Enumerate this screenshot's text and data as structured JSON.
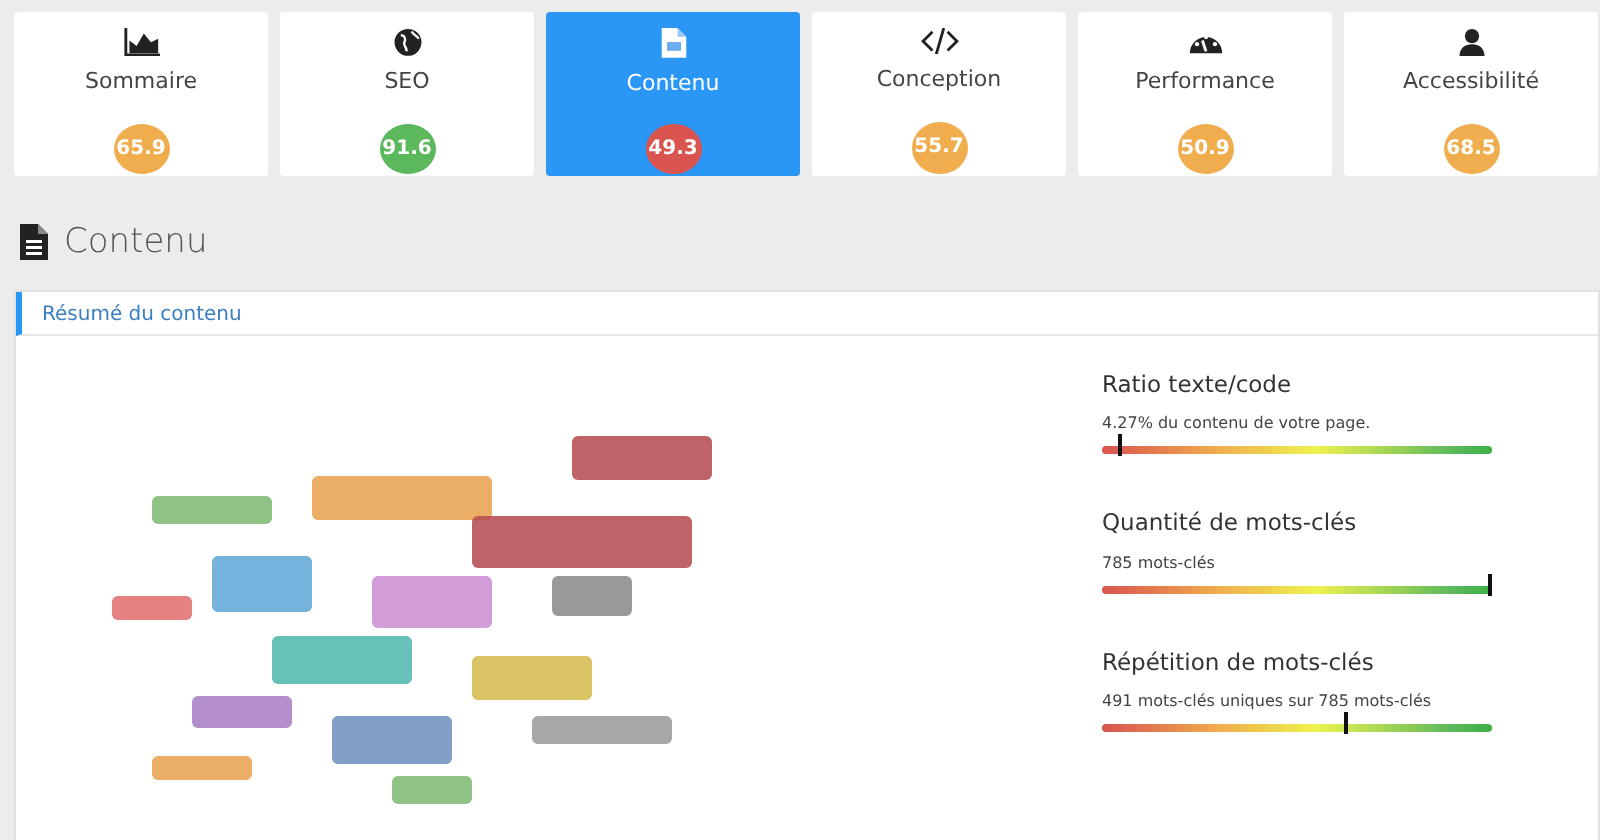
{
  "tabs": [
    {
      "label": "Sommaire",
      "score": "65.9",
      "color": "#f0ad4e",
      "selected": false
    },
    {
      "label": "SEO",
      "score": "91.6",
      "color": "#5cb85c",
      "selected": false
    },
    {
      "label": "Contenu",
      "score": "49.3",
      "color": "#d9534f",
      "selected": true
    },
    {
      "label": "Conception",
      "score": "55.7",
      "color": "#f0ad4e",
      "selected": false
    },
    {
      "label": "Performance",
      "score": "50.9",
      "color": "#f0ad4e",
      "selected": false
    },
    {
      "label": "Accessibilité",
      "score": "68.5",
      "color": "#f0ad4e",
      "selected": false
    }
  ],
  "section_title": "Contenu",
  "panel": {
    "title": "Résumé du contenu",
    "metrics": [
      {
        "title": "Ratio texte/code",
        "detail": "4.27% du contenu de votre page.",
        "level": 0.05
      },
      {
        "title": "Quantité de mots-clés",
        "detail": "785 mots-clés",
        "level": 1.0
      },
      {
        "title": "Répétition de mots-clés",
        "detail": "491 mots-clés uniques sur 785 mots-clés",
        "level": 0.63
      }
    ]
  }
}
